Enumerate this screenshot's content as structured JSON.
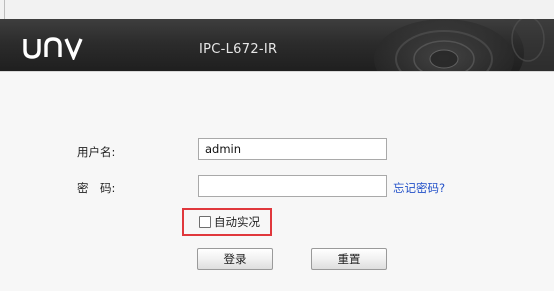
{
  "header": {
    "logo_text": "unv",
    "model": "IPC-L672-IR"
  },
  "login": {
    "username_label": "用户名:",
    "username_value": "admin",
    "password_label": "密　码:",
    "password_value": "",
    "forgot_link": "忘记密码?",
    "auto_live_label": "自动实况",
    "auto_live_checked": false,
    "login_button": "登录",
    "reset_button": "重置"
  },
  "colors": {
    "header_bg": "#2c2c2c",
    "link": "#2250c8",
    "highlight_border": "#e0373c",
    "panel_bg": "#f7f7f7"
  }
}
